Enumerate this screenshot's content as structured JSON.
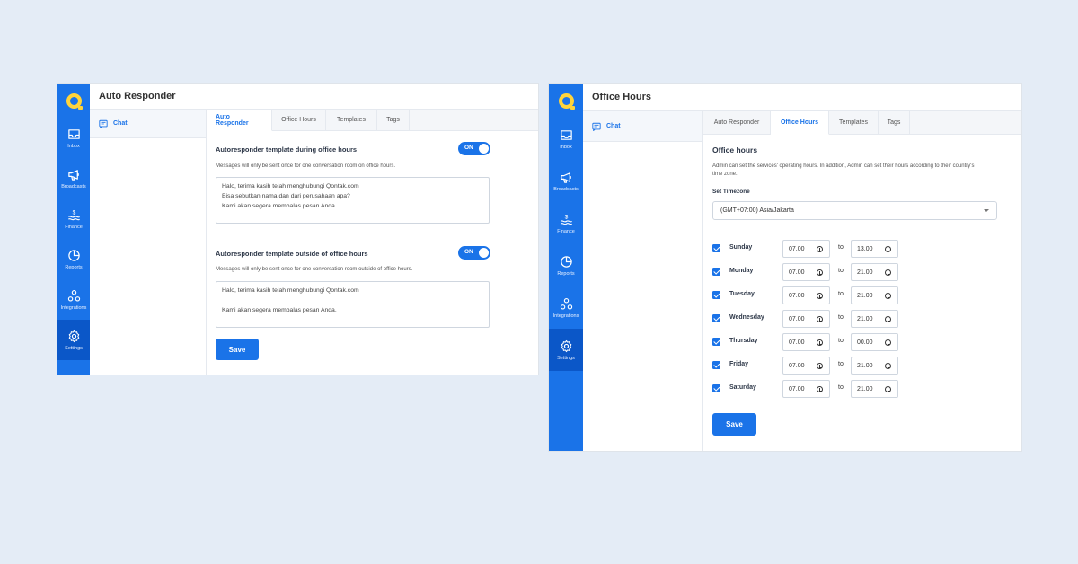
{
  "colors": {
    "accent": "#1a73e8",
    "sidebar_active": "#0b57c8",
    "logo": "#ffd43b",
    "background": "#e4ecf6"
  },
  "sidebar": {
    "items": [
      {
        "label": "Inbox",
        "icon": "inbox-icon"
      },
      {
        "label": "Broadcasts",
        "icon": "megaphone-icon"
      },
      {
        "label": "Finance",
        "icon": "dollar-icon"
      },
      {
        "label": "Reports",
        "icon": "pie-chart-icon"
      },
      {
        "label": "Integrations",
        "icon": "integrations-icon"
      },
      {
        "label": "Settings",
        "icon": "gear-icon"
      }
    ],
    "active": "Settings"
  },
  "window1": {
    "title": "Auto Responder",
    "channel": {
      "label": "Chat",
      "icon": "chat-icon"
    },
    "tabs": [
      "Auto Responder",
      "Office Hours",
      "Templates",
      "Tags"
    ],
    "active_tab": "Auto Responder",
    "section_during": {
      "title": "Autoresponder template during office hours",
      "toggle": "ON",
      "desc": "Messages will only be sent once for one conversation room on office hours.",
      "message_lines": [
        "Halo, terima kasih telah menghubungi Qontak.com",
        "Bisa sebutkan nama dan dari perusahaan apa?",
        "Kami akan segera membalas pesan Anda."
      ]
    },
    "section_outside": {
      "title": "Autoresponder template outside of office hours",
      "toggle": "ON",
      "desc": "Messages will only be sent once for one conversation room outside of office hours.",
      "message_lines": [
        "Halo, terima kasih telah menghubungi Qontak.com",
        "",
        "Kami akan segera membalas pesan Anda."
      ]
    },
    "save_label": "Save"
  },
  "window2": {
    "title": "Office Hours",
    "channel": {
      "label": "Chat",
      "icon": "chat-icon"
    },
    "tabs": [
      "Auto Responder",
      "Office Hours",
      "Templates",
      "Tags"
    ],
    "active_tab": "Office Hours",
    "heading": "Office hours",
    "desc": "Admin can set the services' operating hours. In addition, Admin can set their hours according to their country's time zone.",
    "timezone_label": "Set Timezone",
    "timezone_value": "(GMT+07:00) Asia/Jakarta",
    "to_label": "to",
    "days": [
      {
        "name": "Sunday",
        "checked": true,
        "from": "07.00",
        "to": "13.00"
      },
      {
        "name": "Monday",
        "checked": true,
        "from": "07.00",
        "to": "21.00"
      },
      {
        "name": "Tuesday",
        "checked": true,
        "from": "07.00",
        "to": "21.00"
      },
      {
        "name": "Wednesday",
        "checked": true,
        "from": "07.00",
        "to": "21.00"
      },
      {
        "name": "Thursday",
        "checked": true,
        "from": "07.00",
        "to": "00.00"
      },
      {
        "name": "Friday",
        "checked": true,
        "from": "07.00",
        "to": "21.00"
      },
      {
        "name": "Saturday",
        "checked": true,
        "from": "07.00",
        "to": "21.00"
      }
    ],
    "save_label": "Save"
  }
}
